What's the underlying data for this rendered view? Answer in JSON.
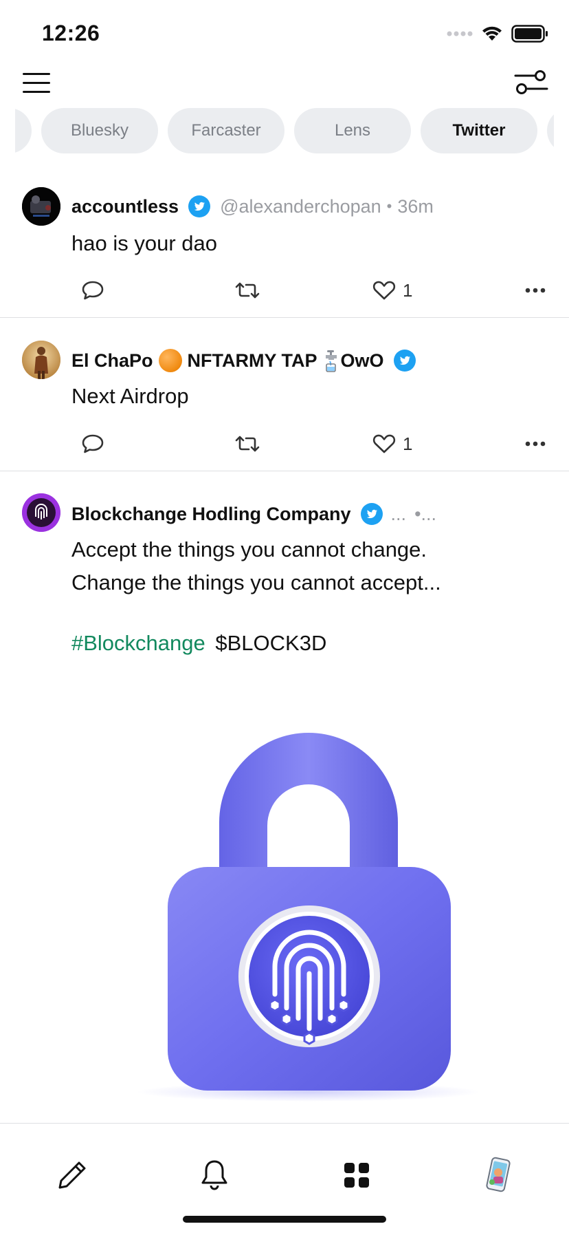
{
  "status_bar": {
    "time": "12:26",
    "signal_icon": "signal-dots-icon",
    "wifi_icon": "wifi-icon",
    "battery_icon": "battery-icon"
  },
  "nav": {
    "menu_icon": "hamburger-menu-icon",
    "filter_icon": "filter-sliders-icon"
  },
  "tabs": [
    {
      "label": ""
    },
    {
      "label": "Bluesky"
    },
    {
      "label": "Farcaster"
    },
    {
      "label": "Lens"
    },
    {
      "label": "Twitter",
      "active": true
    },
    {
      "label": ""
    }
  ],
  "colors": {
    "accent_green": "#12895e",
    "verified_blue": "#1da1f2",
    "tab_bg": "#ebedf0",
    "muted_text": "#9a9ca1",
    "lock_purple": "#6e6ef0"
  },
  "posts": [
    {
      "author": "accountless",
      "handle": "@alexanderchopan",
      "separator": "•",
      "time_ago": "36m",
      "text": "hao is your dao",
      "likes": "1"
    },
    {
      "author": "El ChaPo",
      "author_suffix": "NFTARMY TAP",
      "author_tail": "OwO",
      "text": "Next Airdrop",
      "likes": "1"
    },
    {
      "author": "Blockchange Hodling Company",
      "handle": "...",
      "separator": "•...",
      "text_line1": "Accept the things you cannot change.",
      "text_line2": "Change the things you cannot accept...",
      "hashtag": "#Blockchange",
      "ticker": "$BLOCK3D",
      "image_icon": "fingerprint-padlock-icon"
    }
  ],
  "bottom_bar": {
    "compose_icon": "pencil-icon",
    "notifications_icon": "bell-icon",
    "apps_icon": "grid-icon",
    "profile_icon": "profile-avatar"
  }
}
